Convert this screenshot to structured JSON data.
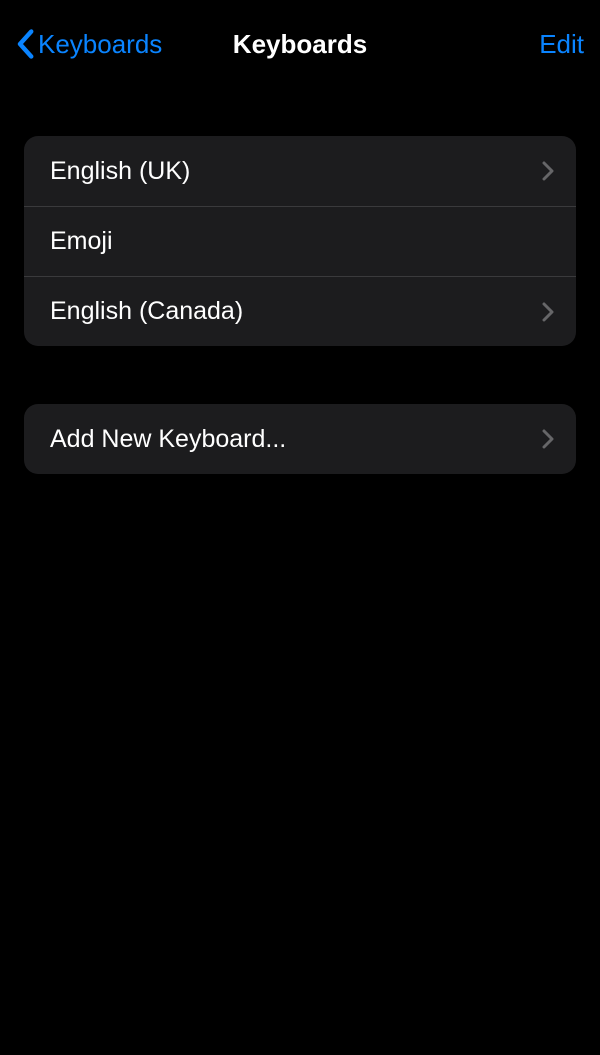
{
  "nav": {
    "back_label": "Keyboards",
    "title": "Keyboards",
    "edit_label": "Edit"
  },
  "keyboards": {
    "items": [
      {
        "label": "English (UK)",
        "has_chevron": true
      },
      {
        "label": "Emoji",
        "has_chevron": false
      },
      {
        "label": "English (Canada)",
        "has_chevron": true
      }
    ]
  },
  "add": {
    "label": "Add New Keyboard..."
  }
}
